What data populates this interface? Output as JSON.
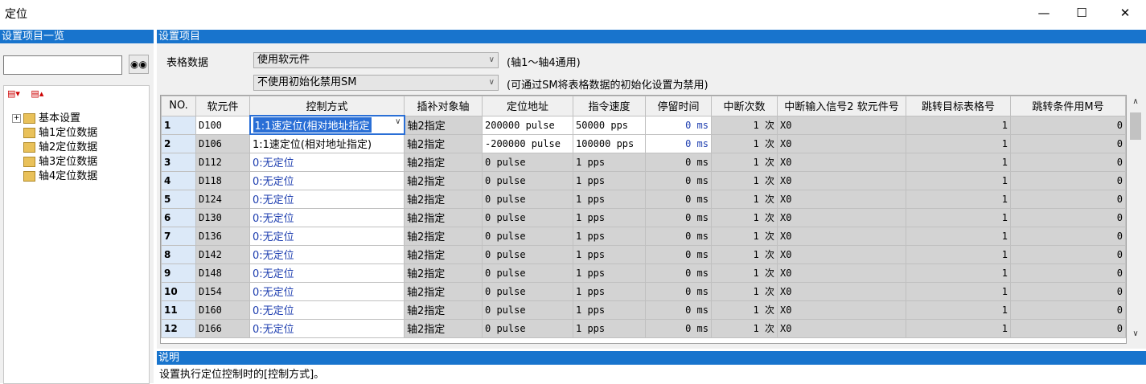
{
  "window": {
    "title": "定位",
    "minimize": "—",
    "maximize": "☐",
    "close": "✕"
  },
  "left_panel": {
    "header": "设置项目一览",
    "search_value": "",
    "find_icon": "binoculars-icon",
    "tree": [
      {
        "label": "基本设置",
        "expander": "+"
      },
      {
        "label": "轴1定位数据"
      },
      {
        "label": "轴2定位数据"
      },
      {
        "label": "轴3定位数据"
      },
      {
        "label": "轴4定位数据"
      }
    ]
  },
  "right_panel": {
    "header": "设置项目",
    "table_data_label": "表格数据",
    "device_combo": "使用软元件",
    "device_note": "(轴1～轴4通用)",
    "init_combo": "不使用初始化禁用SM",
    "init_note": "(可通过SM将表格数据的初始化设置为禁用)"
  },
  "grid": {
    "columns": [
      "NO.",
      "软元件",
      "控制方式",
      "插补对象轴",
      "定位地址",
      "指令速度",
      "停留时间",
      "中断次数",
      "中断输入信号2  软元件号",
      "跳转目标表格号",
      "跳转条件用M号"
    ],
    "rows": [
      {
        "no": "1",
        "dev": "D100",
        "mode": "1:1速定位(相对地址指定",
        "axis": "轴2指定",
        "addr": "200000 pulse",
        "speed": "50000 pps",
        "dwell": "0 ms",
        "count": "1 次",
        "sig": "X0",
        "jump": "1",
        "mno": "0"
      },
      {
        "no": "2",
        "dev": "D106",
        "mode": "1:1速定位(相对地址指定)",
        "axis": "轴2指定",
        "addr": "-200000 pulse",
        "speed": "100000 pps",
        "dwell": "0 ms",
        "count": "1 次",
        "sig": "X0",
        "jump": "1",
        "mno": "0"
      },
      {
        "no": "3",
        "dev": "D112",
        "mode": "0:无定位",
        "axis": "轴2指定",
        "addr": "0 pulse",
        "speed": "1 pps",
        "dwell": "0 ms",
        "count": "1 次",
        "sig": "X0",
        "jump": "1",
        "mno": "0"
      },
      {
        "no": "4",
        "dev": "D118",
        "mode": "0:无定位",
        "axis": "轴2指定",
        "addr": "0 pulse",
        "speed": "1 pps",
        "dwell": "0 ms",
        "count": "1 次",
        "sig": "X0",
        "jump": "1",
        "mno": "0"
      },
      {
        "no": "5",
        "dev": "D124",
        "mode": "0:无定位",
        "axis": "轴2指定",
        "addr": "0 pulse",
        "speed": "1 pps",
        "dwell": "0 ms",
        "count": "1 次",
        "sig": "X0",
        "jump": "1",
        "mno": "0"
      },
      {
        "no": "6",
        "dev": "D130",
        "mode": "0:无定位",
        "axis": "轴2指定",
        "addr": "0 pulse",
        "speed": "1 pps",
        "dwell": "0 ms",
        "count": "1 次",
        "sig": "X0",
        "jump": "1",
        "mno": "0"
      },
      {
        "no": "7",
        "dev": "D136",
        "mode": "0:无定位",
        "axis": "轴2指定",
        "addr": "0 pulse",
        "speed": "1 pps",
        "dwell": "0 ms",
        "count": "1 次",
        "sig": "X0",
        "jump": "1",
        "mno": "0"
      },
      {
        "no": "8",
        "dev": "D142",
        "mode": "0:无定位",
        "axis": "轴2指定",
        "addr": "0 pulse",
        "speed": "1 pps",
        "dwell": "0 ms",
        "count": "1 次",
        "sig": "X0",
        "jump": "1",
        "mno": "0"
      },
      {
        "no": "9",
        "dev": "D148",
        "mode": "0:无定位",
        "axis": "轴2指定",
        "addr": "0 pulse",
        "speed": "1 pps",
        "dwell": "0 ms",
        "count": "1 次",
        "sig": "X0",
        "jump": "1",
        "mno": "0"
      },
      {
        "no": "10",
        "dev": "D154",
        "mode": "0:无定位",
        "axis": "轴2指定",
        "addr": "0 pulse",
        "speed": "1 pps",
        "dwell": "0 ms",
        "count": "1 次",
        "sig": "X0",
        "jump": "1",
        "mno": "0"
      },
      {
        "no": "11",
        "dev": "D160",
        "mode": "0:无定位",
        "axis": "轴2指定",
        "addr": "0 pulse",
        "speed": "1 pps",
        "dwell": "0 ms",
        "count": "1 次",
        "sig": "X0",
        "jump": "1",
        "mno": "0"
      },
      {
        "no": "12",
        "dev": "D166",
        "mode": "0:无定位",
        "axis": "轴2指定",
        "addr": "0 pulse",
        "speed": "1 pps",
        "dwell": "0 ms",
        "count": "1 次",
        "sig": "X0",
        "jump": "1",
        "mno": "0"
      }
    ]
  },
  "description": {
    "header": "说明",
    "text": "设置执行定位控制时的[控制方式]。"
  },
  "colors": {
    "header_blue": "#1874cd",
    "selection": "#2a6fd6",
    "text_blue": "#1f3fb0"
  }
}
